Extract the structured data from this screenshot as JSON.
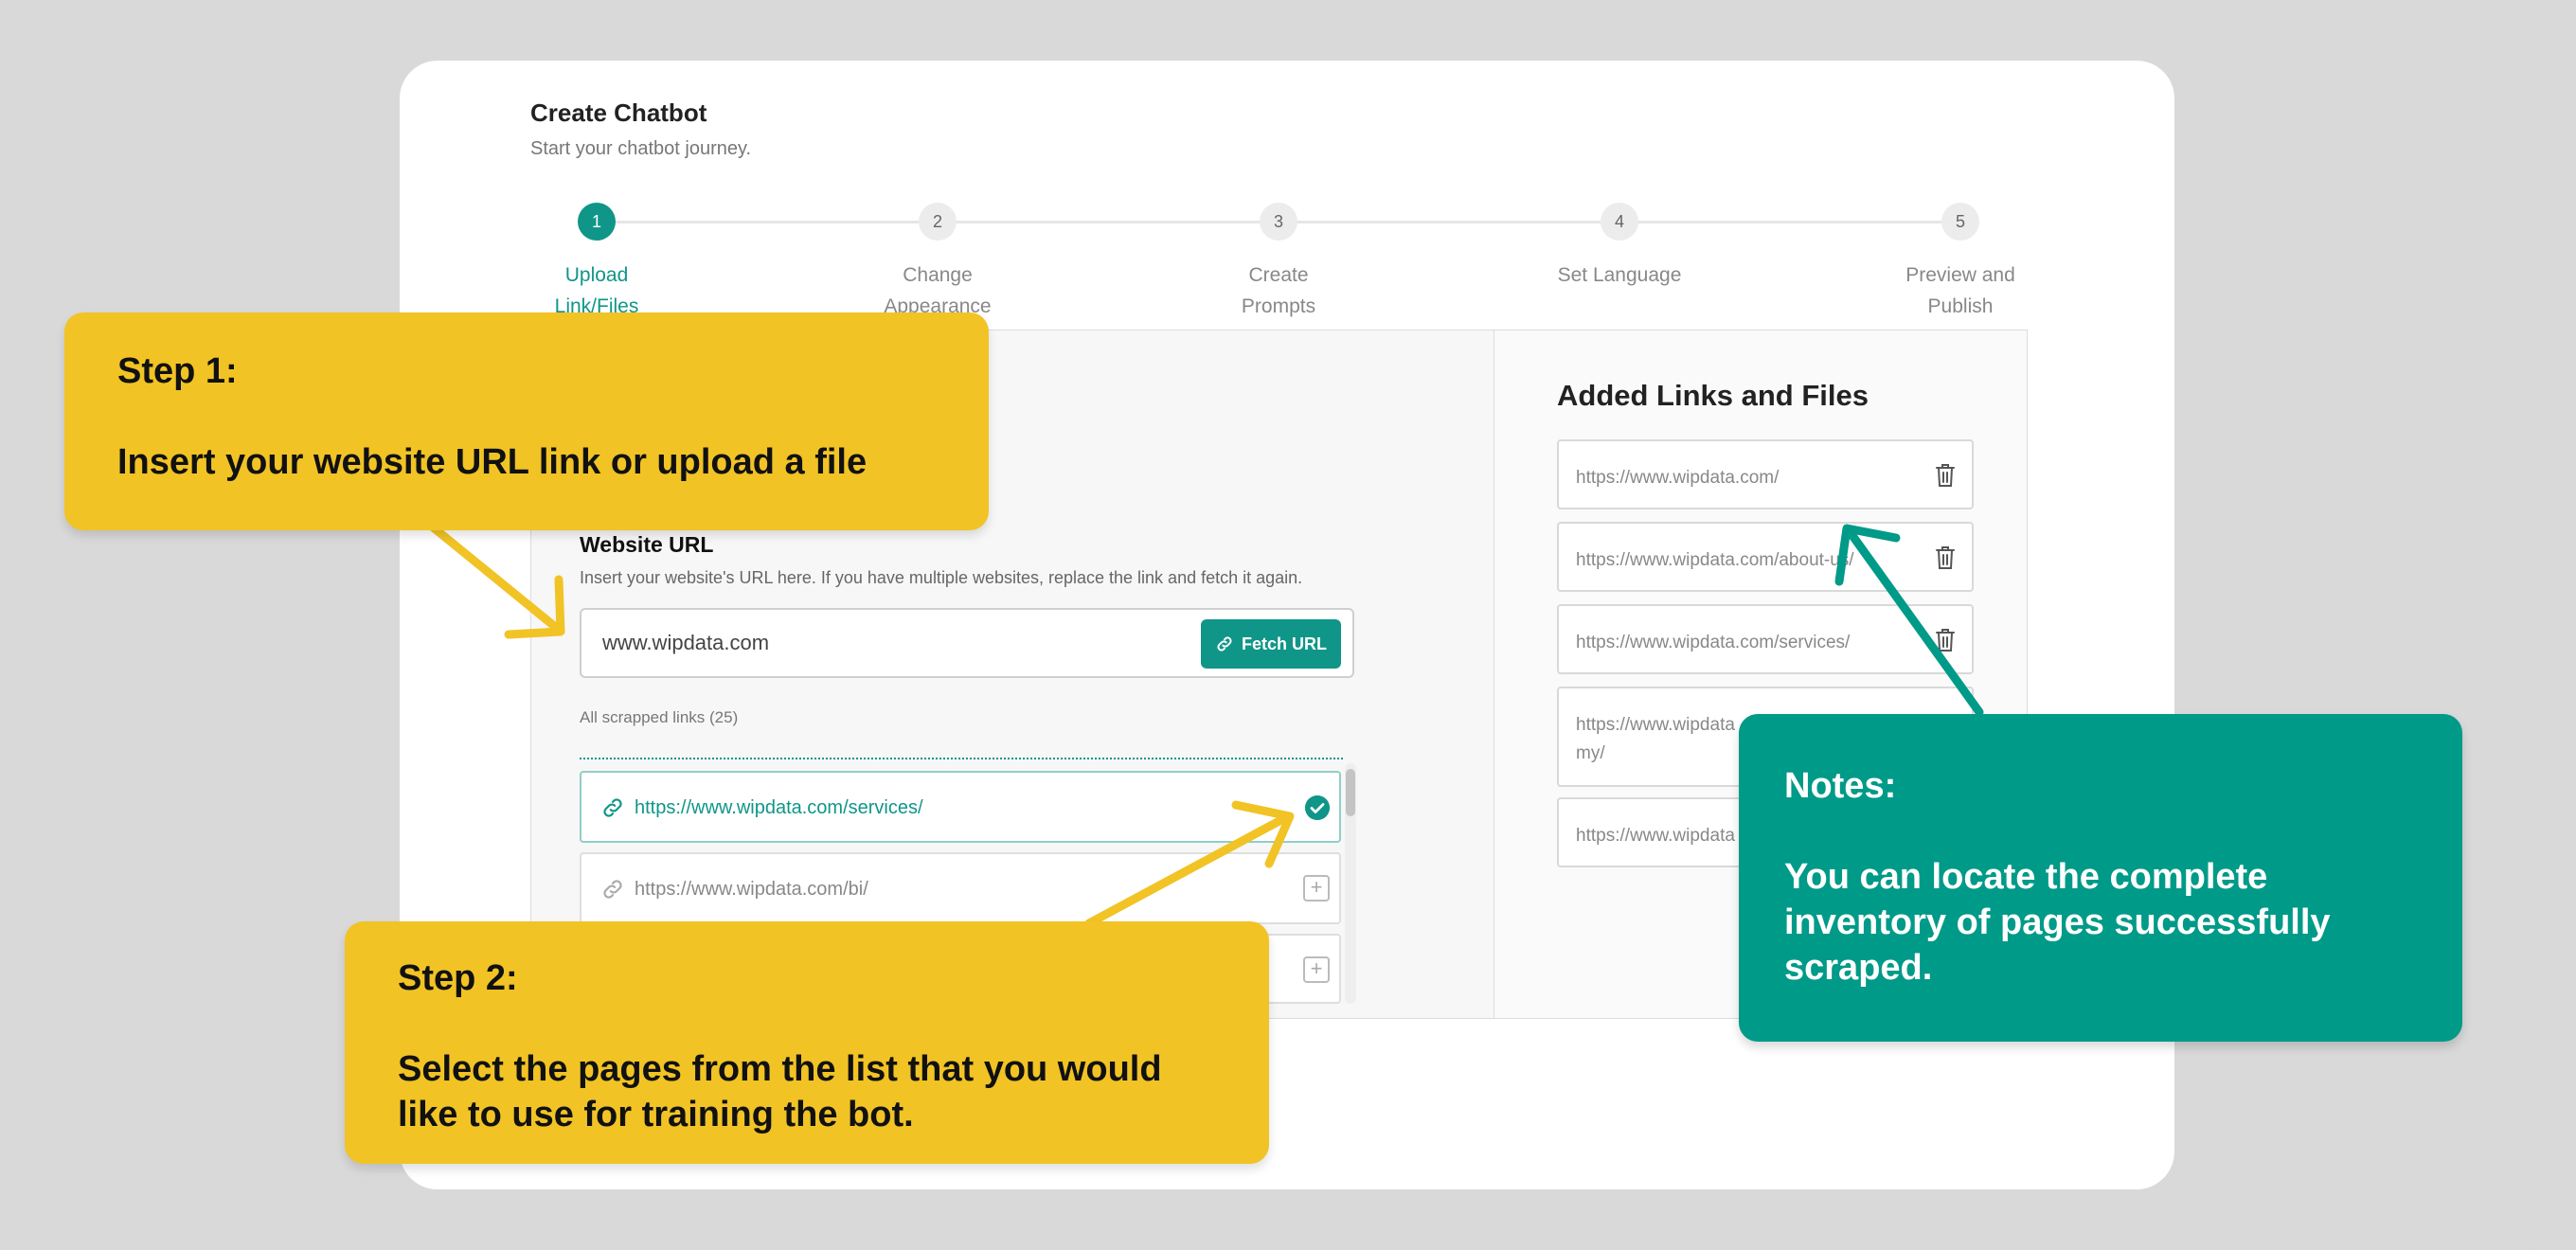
{
  "header": {
    "title": "Create Chatbot",
    "subtitle": "Start your chatbot journey."
  },
  "stepper": [
    {
      "number": "1",
      "line1": "Upload",
      "line2": "Link/Files",
      "active": true
    },
    {
      "number": "2",
      "line1": "Change",
      "line2": "Appearance",
      "active": false
    },
    {
      "number": "3",
      "line1": "Create",
      "line2": "Prompts",
      "active": false
    },
    {
      "number": "4",
      "line1": "Set Language",
      "line2": "",
      "active": false
    },
    {
      "number": "5",
      "line1": "Preview and",
      "line2": "Publish",
      "active": false
    }
  ],
  "website": {
    "title": "Website URL",
    "description": "Insert your website's URL here. If you have multiple websites, replace the link and fetch it again.",
    "url_value": "www.wipdata.com",
    "fetch_label": "Fetch URL",
    "scraped_label": "All scrapped links (25)",
    "links": [
      {
        "url": "https://www.wipdata.com/services/",
        "selected": true
      },
      {
        "url": "https://www.wipdata.com/bi/",
        "selected": false
      },
      {
        "url": "",
        "selected": false
      }
    ]
  },
  "added": {
    "title": "Added Links and Files",
    "items": [
      {
        "text": "https://www.wipdata.com/"
      },
      {
        "text": "https://www.wipdata.com/about-us/"
      },
      {
        "text": "https://www.wipdata.com/services/"
      },
      {
        "text": "https://www.wipdata",
        "text2": "my/"
      },
      {
        "text": "https://www.wipdata"
      }
    ]
  },
  "callouts": {
    "step1": {
      "head": "Step 1:",
      "body": "Insert your website URL link or upload a file"
    },
    "step2": {
      "head": "Step 2:",
      "body": "Select the pages from the list that you would like to use for training the bot."
    },
    "notes": {
      "head": "Notes:",
      "body": "You can locate the complete inventory of pages successfully scraped."
    }
  },
  "colors": {
    "accent": "#0f9688",
    "callout_yellow": "#f1c325",
    "callout_green": "#009a88",
    "background": "#d9d9d9"
  }
}
